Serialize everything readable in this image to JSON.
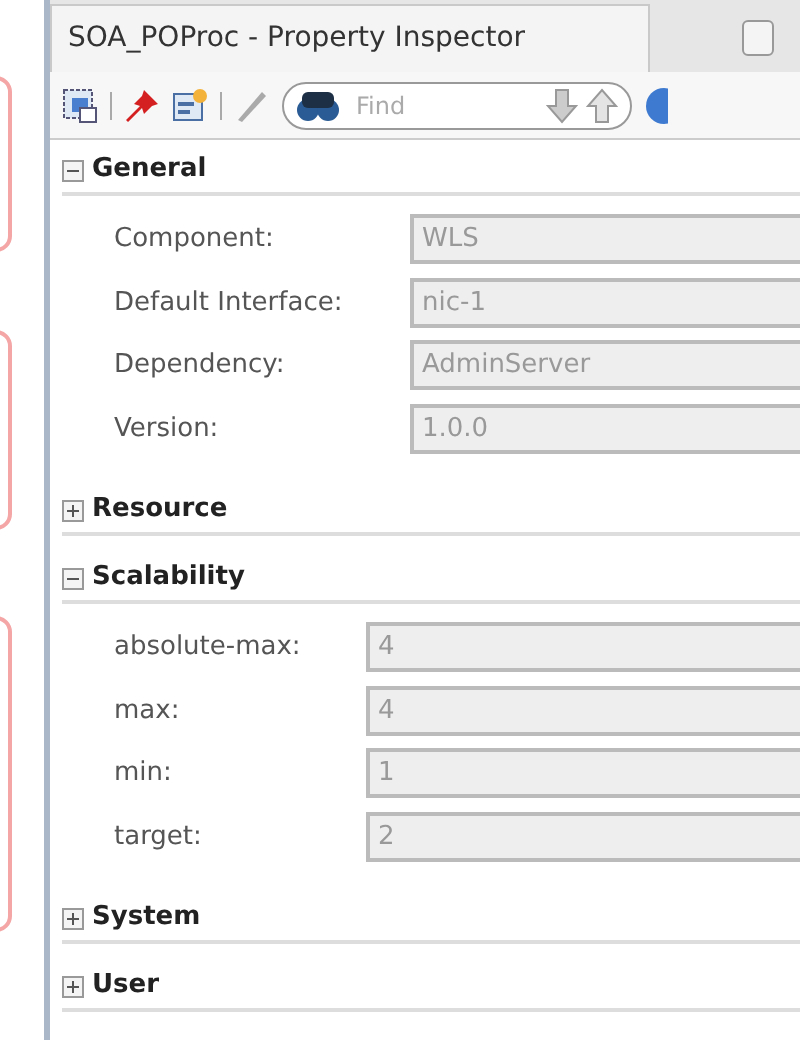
{
  "window": {
    "title": "SOA_POProc - Property Inspector"
  },
  "search": {
    "placeholder": "Find"
  },
  "sections": [
    {
      "title": "General",
      "expanded": true,
      "fields": [
        {
          "label": "Component:",
          "value": "WLS",
          "disabled": true
        },
        {
          "label": "Default Interface:",
          "value": "nic-1",
          "disabled": true
        },
        {
          "label": "Dependency:",
          "value": "AdminServer",
          "disabled": true
        },
        {
          "label": "Version:",
          "value": "1.0.0",
          "disabled": true
        }
      ]
    },
    {
      "title": "Resource",
      "expanded": false
    },
    {
      "title": "Scalability",
      "expanded": true,
      "fields": [
        {
          "label": "absolute-max:",
          "value": "4",
          "disabled": true
        },
        {
          "label": "max:",
          "value": "4",
          "disabled": true
        },
        {
          "label": "min:",
          "value": "1",
          "disabled": true
        },
        {
          "label": "target:",
          "value": "2",
          "disabled": true
        }
      ]
    },
    {
      "title": "System",
      "expanded": false
    },
    {
      "title": "User",
      "expanded": false
    }
  ]
}
